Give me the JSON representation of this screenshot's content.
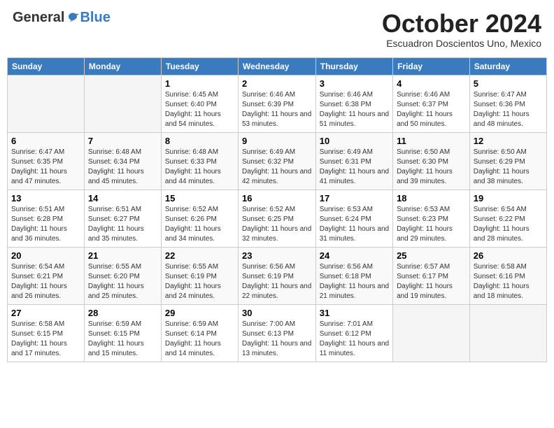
{
  "logo": {
    "general": "General",
    "blue": "Blue"
  },
  "header": {
    "month": "October 2024",
    "location": "Escuadron Doscientos Uno, Mexico"
  },
  "weekdays": [
    "Sunday",
    "Monday",
    "Tuesday",
    "Wednesday",
    "Thursday",
    "Friday",
    "Saturday"
  ],
  "weeks": [
    [
      {
        "day": null
      },
      {
        "day": null
      },
      {
        "day": 1,
        "sunrise": "6:45 AM",
        "sunset": "6:40 PM",
        "daylight": "11 hours and 54 minutes."
      },
      {
        "day": 2,
        "sunrise": "6:46 AM",
        "sunset": "6:39 PM",
        "daylight": "11 hours and 53 minutes."
      },
      {
        "day": 3,
        "sunrise": "6:46 AM",
        "sunset": "6:38 PM",
        "daylight": "11 hours and 51 minutes."
      },
      {
        "day": 4,
        "sunrise": "6:46 AM",
        "sunset": "6:37 PM",
        "daylight": "11 hours and 50 minutes."
      },
      {
        "day": 5,
        "sunrise": "6:47 AM",
        "sunset": "6:36 PM",
        "daylight": "11 hours and 48 minutes."
      }
    ],
    [
      {
        "day": 6,
        "sunrise": "6:47 AM",
        "sunset": "6:35 PM",
        "daylight": "11 hours and 47 minutes."
      },
      {
        "day": 7,
        "sunrise": "6:48 AM",
        "sunset": "6:34 PM",
        "daylight": "11 hours and 45 minutes."
      },
      {
        "day": 8,
        "sunrise": "6:48 AM",
        "sunset": "6:33 PM",
        "daylight": "11 hours and 44 minutes."
      },
      {
        "day": 9,
        "sunrise": "6:49 AM",
        "sunset": "6:32 PM",
        "daylight": "11 hours and 42 minutes."
      },
      {
        "day": 10,
        "sunrise": "6:49 AM",
        "sunset": "6:31 PM",
        "daylight": "11 hours and 41 minutes."
      },
      {
        "day": 11,
        "sunrise": "6:50 AM",
        "sunset": "6:30 PM",
        "daylight": "11 hours and 39 minutes."
      },
      {
        "day": 12,
        "sunrise": "6:50 AM",
        "sunset": "6:29 PM",
        "daylight": "11 hours and 38 minutes."
      }
    ],
    [
      {
        "day": 13,
        "sunrise": "6:51 AM",
        "sunset": "6:28 PM",
        "daylight": "11 hours and 36 minutes."
      },
      {
        "day": 14,
        "sunrise": "6:51 AM",
        "sunset": "6:27 PM",
        "daylight": "11 hours and 35 minutes."
      },
      {
        "day": 15,
        "sunrise": "6:52 AM",
        "sunset": "6:26 PM",
        "daylight": "11 hours and 34 minutes."
      },
      {
        "day": 16,
        "sunrise": "6:52 AM",
        "sunset": "6:25 PM",
        "daylight": "11 hours and 32 minutes."
      },
      {
        "day": 17,
        "sunrise": "6:53 AM",
        "sunset": "6:24 PM",
        "daylight": "11 hours and 31 minutes."
      },
      {
        "day": 18,
        "sunrise": "6:53 AM",
        "sunset": "6:23 PM",
        "daylight": "11 hours and 29 minutes."
      },
      {
        "day": 19,
        "sunrise": "6:54 AM",
        "sunset": "6:22 PM",
        "daylight": "11 hours and 28 minutes."
      }
    ],
    [
      {
        "day": 20,
        "sunrise": "6:54 AM",
        "sunset": "6:21 PM",
        "daylight": "11 hours and 26 minutes."
      },
      {
        "day": 21,
        "sunrise": "6:55 AM",
        "sunset": "6:20 PM",
        "daylight": "11 hours and 25 minutes."
      },
      {
        "day": 22,
        "sunrise": "6:55 AM",
        "sunset": "6:19 PM",
        "daylight": "11 hours and 24 minutes."
      },
      {
        "day": 23,
        "sunrise": "6:56 AM",
        "sunset": "6:19 PM",
        "daylight": "11 hours and 22 minutes."
      },
      {
        "day": 24,
        "sunrise": "6:56 AM",
        "sunset": "6:18 PM",
        "daylight": "11 hours and 21 minutes."
      },
      {
        "day": 25,
        "sunrise": "6:57 AM",
        "sunset": "6:17 PM",
        "daylight": "11 hours and 19 minutes."
      },
      {
        "day": 26,
        "sunrise": "6:58 AM",
        "sunset": "6:16 PM",
        "daylight": "11 hours and 18 minutes."
      }
    ],
    [
      {
        "day": 27,
        "sunrise": "6:58 AM",
        "sunset": "6:15 PM",
        "daylight": "11 hours and 17 minutes."
      },
      {
        "day": 28,
        "sunrise": "6:59 AM",
        "sunset": "6:15 PM",
        "daylight": "11 hours and 15 minutes."
      },
      {
        "day": 29,
        "sunrise": "6:59 AM",
        "sunset": "6:14 PM",
        "daylight": "11 hours and 14 minutes."
      },
      {
        "day": 30,
        "sunrise": "7:00 AM",
        "sunset": "6:13 PM",
        "daylight": "11 hours and 13 minutes."
      },
      {
        "day": 31,
        "sunrise": "7:01 AM",
        "sunset": "6:12 PM",
        "daylight": "11 hours and 11 minutes."
      },
      {
        "day": null
      },
      {
        "day": null
      }
    ]
  ]
}
